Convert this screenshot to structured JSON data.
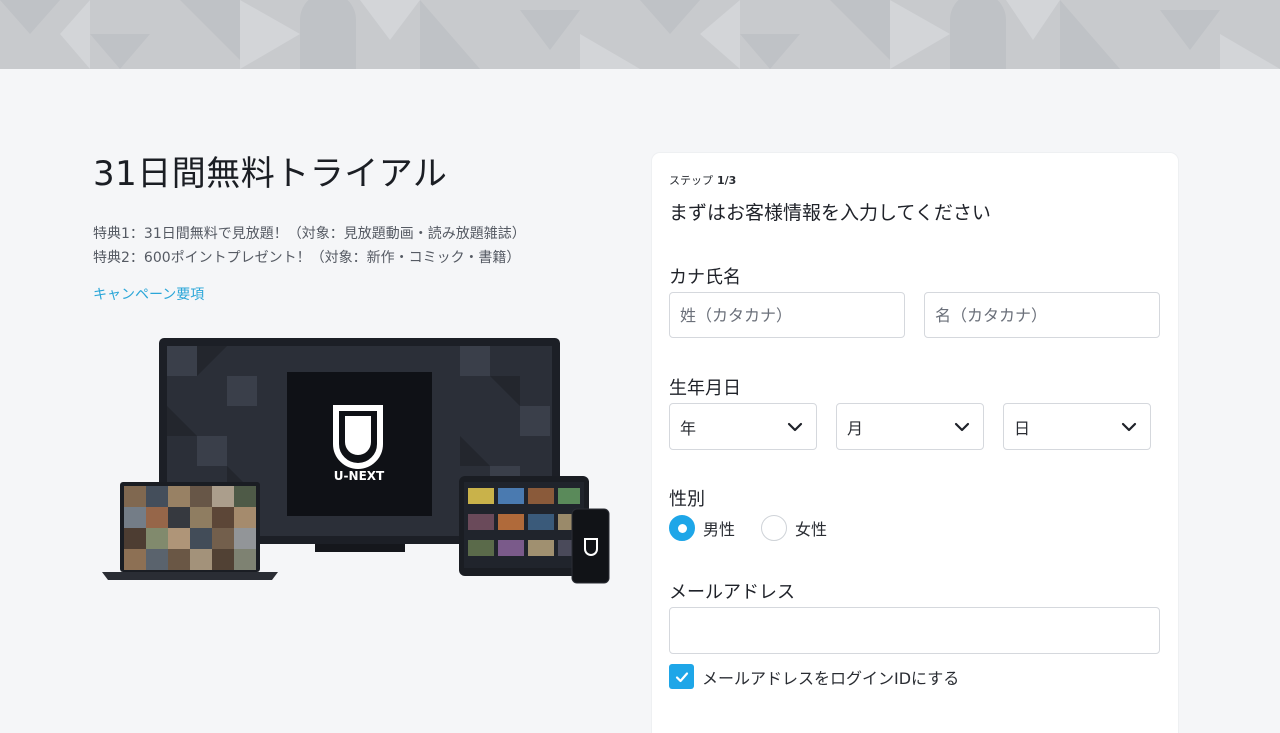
{
  "hero": {
    "title": "31日間無料トライアル",
    "perk1": "特典1：31日間無料で見放題！（対象：見放題動画・読み放題雑誌）",
    "perk2": "特典2：600ポイントプレゼント！（対象：新作・コミック・書籍）",
    "campaign_link": "キャンペーン要項",
    "brand_name": "U-NEXT"
  },
  "form": {
    "step_label": "ステップ",
    "step_value": "1/3",
    "title": "まずはお客様情報を入力してください",
    "kana_label": "カナ氏名",
    "last_name_placeholder": "姓（カタカナ）",
    "first_name_placeholder": "名（カタカナ）",
    "birth_label": "生年月日",
    "year_value": "年",
    "month_value": "月",
    "day_value": "日",
    "gender_label": "性別",
    "male_label": "男性",
    "female_label": "女性",
    "email_label": "メールアドレス",
    "email_value": "",
    "login_id_label": "メールアドレスをログインIDにする"
  },
  "colors": {
    "accent": "#1ea6e8",
    "link": "#2aa6d8",
    "background": "#f5f6f8"
  }
}
